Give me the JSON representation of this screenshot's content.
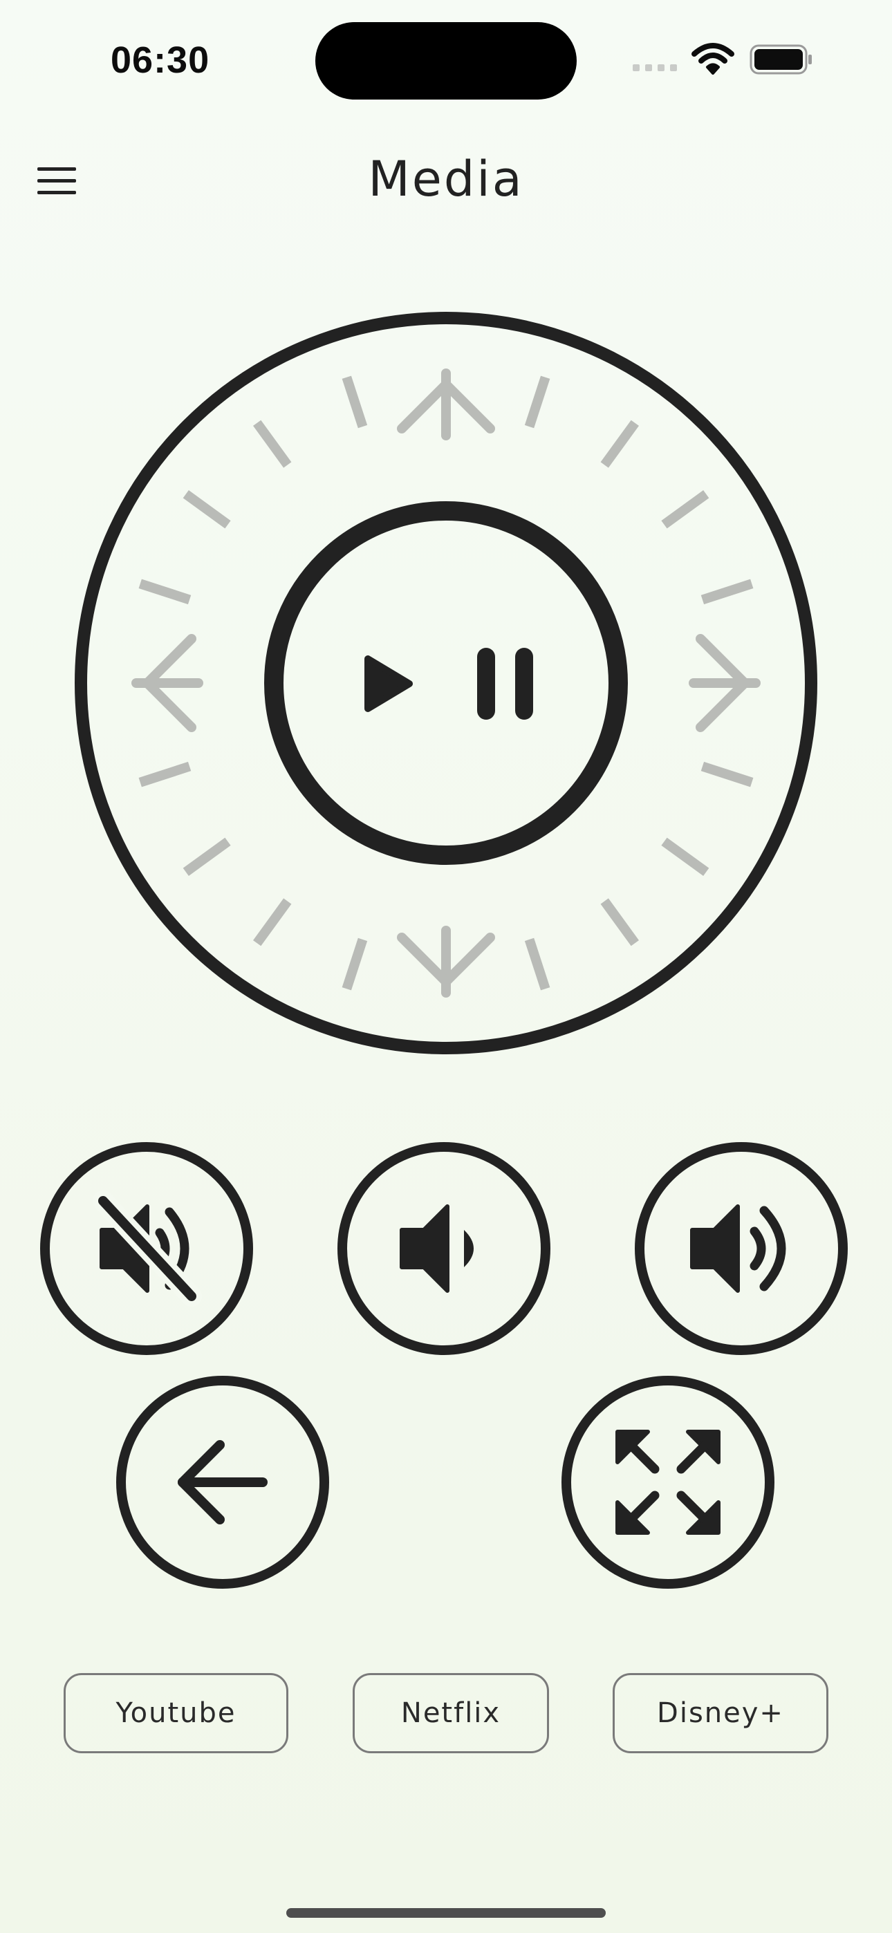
{
  "status_bar": {
    "time": "06:30",
    "icons": [
      "signal-dots-icon",
      "wifi-icon",
      "battery-icon"
    ]
  },
  "header": {
    "title": "Media",
    "menu_icon": "hamburger-menu-icon"
  },
  "dial": {
    "center_icon": "play-pause-icon",
    "directions": [
      "up-arrow-icon",
      "down-arrow-icon",
      "left-arrow-icon",
      "right-arrow-icon"
    ]
  },
  "controls": [
    {
      "name": "mute-button",
      "icon": "volume-mute-icon"
    },
    {
      "name": "volume-down-button",
      "icon": "volume-down-icon"
    },
    {
      "name": "volume-up-button",
      "icon": "volume-up-icon"
    },
    {
      "name": "back-button",
      "icon": "back-arrow-icon"
    },
    {
      "name": "fullscreen-button",
      "icon": "fullscreen-icon"
    }
  ],
  "apps": [
    {
      "label": "Youtube"
    },
    {
      "label": "Netflix"
    },
    {
      "label": "Disney+"
    }
  ],
  "colors": {
    "background": "#f4f9f0",
    "foreground": "#222222",
    "tick": "#b9bbb7",
    "pill_border": "#7a7a7a"
  }
}
